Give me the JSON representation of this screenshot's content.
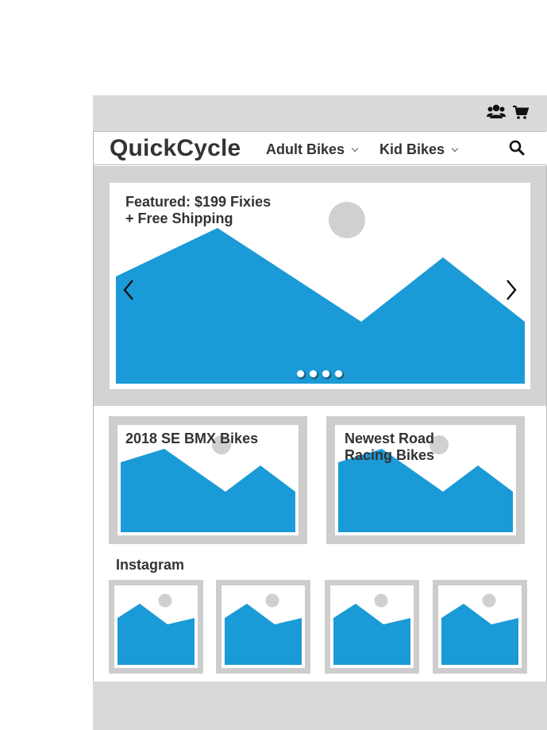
{
  "header": {
    "logo": "QuickCycle",
    "nav": [
      {
        "label": "Adult Bikes"
      },
      {
        "label": "Kid Bikes"
      }
    ],
    "icons": [
      "users-icon",
      "cart-icon",
      "search-icon"
    ]
  },
  "hero": {
    "caption_line1": "Featured: $199 Fixies",
    "caption_line2": "+ Free Shipping",
    "slide_count": 4,
    "active_slide": 1
  },
  "promos": [
    {
      "title_line1": "2018 SE BMX Bikes",
      "title_line2": ""
    },
    {
      "title_line1": "Newest Road",
      "title_line2": "Racing Bikes"
    }
  ],
  "instagram": {
    "heading": "Instagram",
    "thumb_count": 4
  },
  "colors": {
    "frame_gray": "#d9d9d9",
    "placeholder_blue": "#1a9ad6",
    "placeholder_sun": "#d0d0d0",
    "text": "#333333"
  }
}
